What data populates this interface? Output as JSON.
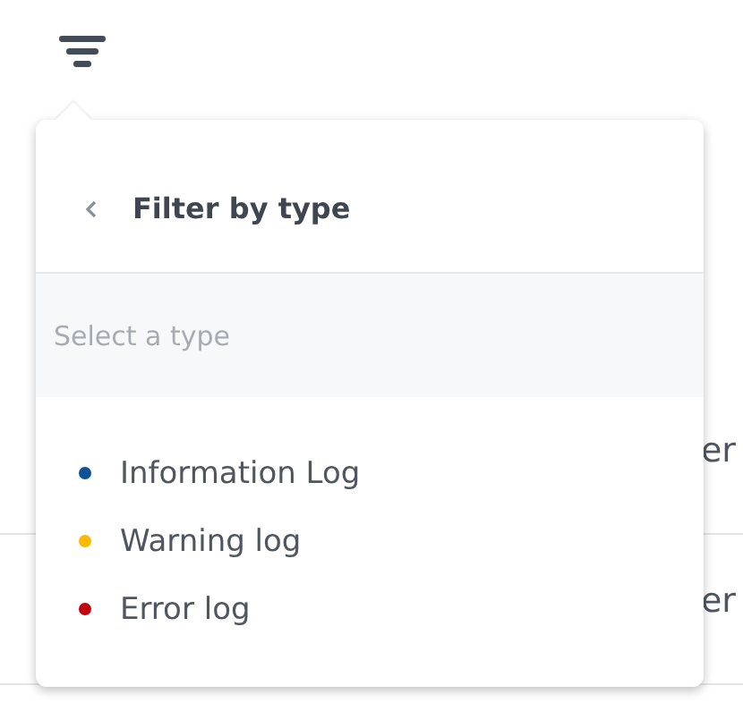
{
  "background_rows": [
    {
      "text": "er"
    },
    {
      "text": "er"
    }
  ],
  "filter_popover": {
    "title": "Filter by type",
    "search": {
      "placeholder": "Select a type"
    },
    "options": [
      {
        "label": "Information Log",
        "color": "#0b5394"
      },
      {
        "label": "Warning log",
        "color": "#fbb900"
      },
      {
        "label": "Error log",
        "color": "#c0000d"
      }
    ]
  }
}
